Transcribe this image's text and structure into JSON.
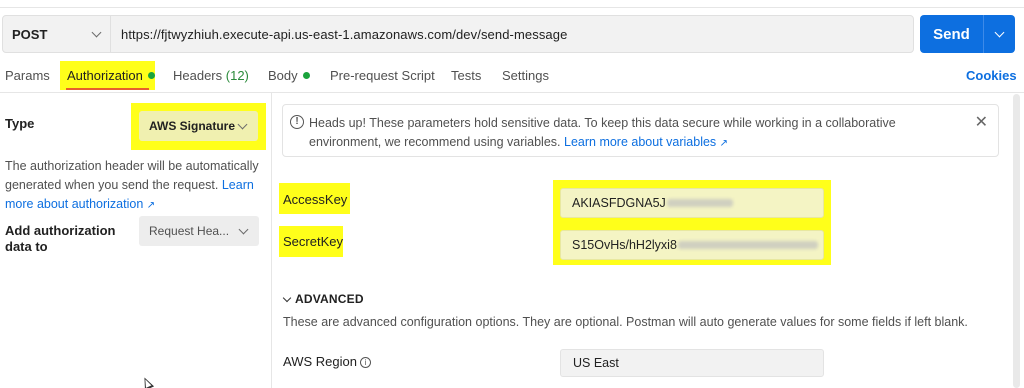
{
  "request": {
    "method": "POST",
    "url": "https://fjtwyzhiuh.execute-api.us-east-1.amazonaws.com/dev/send-message",
    "send_label": "Send"
  },
  "tabs": [
    {
      "label": "Params"
    },
    {
      "label": "Authorization",
      "active": true,
      "has_dot": true
    },
    {
      "label": "Headers",
      "count": "(12)"
    },
    {
      "label": "Body",
      "has_dot": true
    },
    {
      "label": "Pre-request Script"
    },
    {
      "label": "Tests"
    },
    {
      "label": "Settings"
    }
  ],
  "cookies_label": "Cookies",
  "auth": {
    "type_label": "Type",
    "type_value": "AWS Signature",
    "description": "The authorization header will be automatically generated when you send the request.",
    "learn_more": "Learn more about authorization",
    "add_to_label": "Add authorization data to",
    "add_to_value": "Request Hea..."
  },
  "banner": {
    "text": "Heads up! These parameters hold sensitive data. To keep this data secure while working in a collaborative environment, we recommend using variables.",
    "link": "Learn more about variables"
  },
  "fields": {
    "access_key_label": "AccessKey",
    "access_key_value": "AKIASFDGNA5J",
    "secret_key_label": "SecretKey",
    "secret_key_value": "S15OvHs/hH2lyxi8"
  },
  "advanced": {
    "heading": "ADVANCED",
    "description": "These are advanced configuration options. They are optional. Postman will auto generate values for some fields if left blank.",
    "region_label": "AWS Region",
    "region_value": "US East"
  },
  "colors": {
    "accent": "#0d6fe0",
    "highlight": "#ffff1a",
    "active_underline": "#e8602c",
    "status_dot": "#1aa33c"
  }
}
